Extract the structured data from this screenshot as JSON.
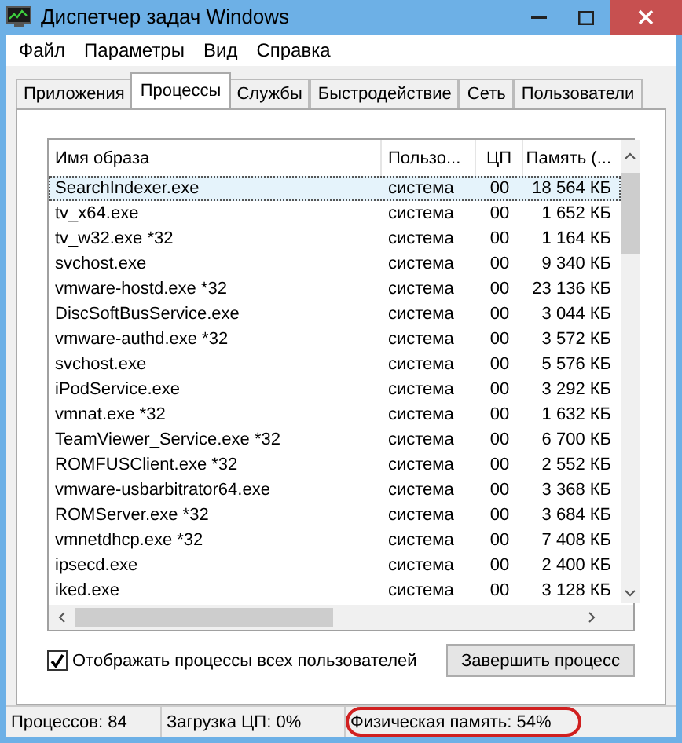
{
  "window": {
    "title": "Диспетчер задач Windows"
  },
  "menu": [
    "Файл",
    "Параметры",
    "Вид",
    "Справка"
  ],
  "tabs": [
    {
      "label": "Приложения",
      "selected": false
    },
    {
      "label": "Процессы",
      "selected": true
    },
    {
      "label": "Службы",
      "selected": false
    },
    {
      "label": "Быстродействие",
      "selected": false
    },
    {
      "label": "Сеть",
      "selected": false
    },
    {
      "label": "Пользователи",
      "selected": false
    }
  ],
  "table": {
    "columns": [
      "Имя образа",
      "Пользо...",
      "ЦП",
      "Память (..."
    ],
    "rows": [
      {
        "cells": [
          "SearchIndexer.exe",
          "система",
          "00",
          "18 564 КБ"
        ],
        "selected": true
      },
      {
        "cells": [
          "tv_x64.exe",
          "система",
          "00",
          "1 652 КБ"
        ],
        "selected": false
      },
      {
        "cells": [
          "tv_w32.exe *32",
          "система",
          "00",
          "1 164 КБ"
        ],
        "selected": false
      },
      {
        "cells": [
          "svchost.exe",
          "система",
          "00",
          "9 340 КБ"
        ],
        "selected": false
      },
      {
        "cells": [
          "vmware-hostd.exe *32",
          "система",
          "00",
          "23 136 КБ"
        ],
        "selected": false
      },
      {
        "cells": [
          "DiscSoftBusService.exe",
          "система",
          "00",
          "3 044 КБ"
        ],
        "selected": false
      },
      {
        "cells": [
          "vmware-authd.exe *32",
          "система",
          "00",
          "3 572 КБ"
        ],
        "selected": false
      },
      {
        "cells": [
          "svchost.exe",
          "система",
          "00",
          "5 576 КБ"
        ],
        "selected": false
      },
      {
        "cells": [
          "iPodService.exe",
          "система",
          "00",
          "3 292 КБ"
        ],
        "selected": false
      },
      {
        "cells": [
          "vmnat.exe *32",
          "система",
          "00",
          "1 632 КБ"
        ],
        "selected": false
      },
      {
        "cells": [
          "TeamViewer_Service.exe *32",
          "система",
          "00",
          "6 700 КБ"
        ],
        "selected": false
      },
      {
        "cells": [
          "ROMFUSClient.exe *32",
          "система",
          "00",
          "2 552 КБ"
        ],
        "selected": false
      },
      {
        "cells": [
          "vmware-usbarbitrator64.exe",
          "система",
          "00",
          "3 368 КБ"
        ],
        "selected": false
      },
      {
        "cells": [
          "ROMServer.exe *32",
          "система",
          "00",
          "3 684 КБ"
        ],
        "selected": false
      },
      {
        "cells": [
          "vmnetdhcp.exe *32",
          "система",
          "00",
          "7 408 КБ"
        ],
        "selected": false
      },
      {
        "cells": [
          "ipsecd.exe",
          "система",
          "00",
          "2 400 КБ"
        ],
        "selected": false
      },
      {
        "cells": [
          "iked.exe",
          "система",
          "00",
          "3 128 КБ"
        ],
        "selected": false
      }
    ]
  },
  "show_all_users": {
    "label": "Отображать процессы всех пользователей",
    "checked": true
  },
  "end_process_button": "Завершить процесс",
  "status_bar": [
    {
      "text": "Процессов: 84",
      "highlighted": false
    },
    {
      "text": "Загрузка ЦП: 0%",
      "highlighted": false
    },
    {
      "text": "Физическая память: 54%",
      "highlighted": true
    }
  ]
}
